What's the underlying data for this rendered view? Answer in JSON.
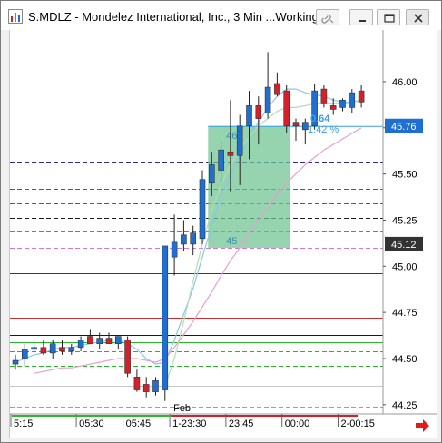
{
  "window": {
    "title": "S.MDLZ - Mondelez International, Inc., 3 Min ...Working...",
    "buttons": [
      "link",
      "minimize",
      "restore",
      "close"
    ]
  },
  "colors": {
    "up": "#1f6fd1",
    "down": "#d32029",
    "target_box": "#6cc38f",
    "measure_text": "#3aa0dd",
    "price_badge_current": "#1f6fd1",
    "price_badge_other": "#333333",
    "scroll_arrow": "#e41a1a"
  },
  "chart_data": {
    "type": "candlestick",
    "ylim": [
      44.2,
      46.28
    ],
    "y_ticks": [
      "46.00",
      "45.75",
      "45.50",
      "45.25",
      "45.00",
      "44.75",
      "44.50",
      "44.25"
    ],
    "y_tick_values": [
      46.0,
      45.75,
      45.5,
      45.25,
      45.0,
      44.75,
      44.5,
      44.25
    ],
    "x_ticks": [
      "5:15",
      "05:30",
      "05:45",
      "1-23:30",
      "23:45",
      "00:00",
      "2-00:15"
    ],
    "x_tick_bar_index": [
      0,
      7,
      12,
      17,
      23,
      29,
      35
    ],
    "day_label": "Feb",
    "day_label_bar_index": 17,
    "candles": [
      {
        "o": 44.47,
        "h": 44.52,
        "l": 44.44,
        "c": 44.49
      },
      {
        "o": 44.5,
        "h": 44.58,
        "l": 44.46,
        "c": 44.55
      },
      {
        "o": 44.55,
        "h": 44.6,
        "l": 44.53,
        "c": 44.56
      },
      {
        "o": 44.56,
        "h": 44.6,
        "l": 44.52,
        "c": 44.53
      },
      {
        "o": 44.53,
        "h": 44.6,
        "l": 44.5,
        "c": 44.58
      },
      {
        "o": 44.56,
        "h": 44.6,
        "l": 44.52,
        "c": 44.54
      },
      {
        "o": 44.54,
        "h": 44.58,
        "l": 44.52,
        "c": 44.56
      },
      {
        "o": 44.56,
        "h": 44.62,
        "l": 44.54,
        "c": 44.6
      },
      {
        "o": 44.62,
        "h": 44.66,
        "l": 44.58,
        "c": 44.58
      },
      {
        "o": 44.58,
        "h": 44.64,
        "l": 44.55,
        "c": 44.61
      },
      {
        "o": 44.61,
        "h": 44.64,
        "l": 44.58,
        "c": 44.58
      },
      {
        "o": 44.58,
        "h": 44.62,
        "l": 44.55,
        "c": 44.62
      },
      {
        "o": 44.6,
        "h": 44.62,
        "l": 44.4,
        "c": 44.42
      },
      {
        "o": 44.4,
        "h": 44.44,
        "l": 44.32,
        "c": 44.33
      },
      {
        "o": 44.36,
        "h": 44.4,
        "l": 44.29,
        "c": 44.32
      },
      {
        "o": 44.32,
        "h": 44.4,
        "l": 44.3,
        "c": 44.38
      },
      {
        "o": 44.33,
        "h": 45.11,
        "l": 44.27,
        "c": 45.11
      },
      {
        "o": 45.05,
        "h": 45.28,
        "l": 44.95,
        "c": 45.13
      },
      {
        "o": 45.12,
        "h": 45.25,
        "l": 45.08,
        "c": 45.17
      },
      {
        "o": 45.12,
        "h": 45.22,
        "l": 45.06,
        "c": 45.18
      },
      {
        "o": 45.15,
        "h": 45.52,
        "l": 45.12,
        "c": 45.47
      },
      {
        "o": 45.45,
        "h": 45.62,
        "l": 45.38,
        "c": 45.55
      },
      {
        "o": 45.52,
        "h": 45.68,
        "l": 45.45,
        "c": 45.63
      },
      {
        "o": 45.62,
        "h": 45.9,
        "l": 45.4,
        "c": 45.6
      },
      {
        "o": 45.6,
        "h": 45.82,
        "l": 45.44,
        "c": 45.76
      },
      {
        "o": 45.76,
        "h": 45.95,
        "l": 45.58,
        "c": 45.87
      },
      {
        "o": 45.87,
        "h": 45.92,
        "l": 45.66,
        "c": 45.8
      },
      {
        "o": 45.83,
        "h": 46.16,
        "l": 45.8,
        "c": 45.97
      },
      {
        "o": 45.99,
        "h": 46.05,
        "l": 45.92,
        "c": 45.93
      },
      {
        "o": 45.95,
        "h": 45.98,
        "l": 45.72,
        "c": 45.76
      },
      {
        "o": 45.78,
        "h": 45.8,
        "l": 45.68,
        "c": 45.76
      },
      {
        "o": 45.74,
        "h": 45.8,
        "l": 45.66,
        "c": 45.78
      },
      {
        "o": 45.76,
        "h": 45.99,
        "l": 45.74,
        "c": 45.95
      },
      {
        "o": 45.96,
        "h": 45.98,
        "l": 45.86,
        "c": 45.88
      },
      {
        "o": 45.87,
        "h": 45.91,
        "l": 45.82,
        "c": 45.85
      },
      {
        "o": 45.86,
        "h": 45.91,
        "l": 45.84,
        "c": 45.9
      },
      {
        "o": 45.86,
        "h": 45.96,
        "l": 45.83,
        "c": 45.94
      },
      {
        "o": 45.95,
        "h": 45.98,
        "l": 45.86,
        "c": 45.89
      }
    ],
    "horizontal_levels": [
      {
        "y": 45.56,
        "color": "#2b2ba8",
        "dash": true
      },
      {
        "y": 45.42,
        "color": "#8a3a8a",
        "dash": true
      },
      {
        "y": 45.34,
        "color": "#c03030",
        "dash": true
      },
      {
        "y": 45.26,
        "color": "#1a1a1a",
        "dash": true
      },
      {
        "y": 45.19,
        "color": "#29b429",
        "dash": true
      },
      {
        "y": 45.1,
        "color": "#d27ad2",
        "dash": true
      },
      {
        "y": 44.96,
        "color": "#2b2bb8",
        "dash": false
      },
      {
        "y": 44.82,
        "color": "#8a3a8a",
        "dash": false
      },
      {
        "y": 44.72,
        "color": "#c03030",
        "dash": false
      },
      {
        "y": 44.63,
        "color": "#1a1a1a",
        "dash": false
      },
      {
        "y": 44.59,
        "color": "#29b429",
        "dash": false
      },
      {
        "y": 44.54,
        "color": "#29b429",
        "dash": true
      },
      {
        "y": 44.5,
        "color": "#29b429",
        "dash": false
      },
      {
        "y": 44.46,
        "color": "#29b429",
        "dash": true
      },
      {
        "y": 44.35,
        "color": "#c8c8c8",
        "dash": false
      },
      {
        "y": 44.24,
        "color": "#d27ad2",
        "dash": true
      }
    ],
    "moving_averages": [
      {
        "name": "",
        "color": "#8cc4ec",
        "values": [
          44.48,
          44.5,
          44.52,
          44.53,
          44.55,
          44.56,
          44.56,
          44.57,
          44.58,
          44.59,
          44.6,
          44.6,
          44.58,
          44.55,
          44.5,
          44.47,
          44.48,
          44.6,
          44.74,
          44.88,
          45.05,
          45.22,
          45.38,
          45.5,
          45.6,
          45.7,
          45.78,
          45.86,
          45.92,
          45.96,
          45.96,
          45.94,
          45.93,
          45.92,
          45.9,
          45.89,
          45.89,
          45.9
        ]
      },
      {
        "name": "",
        "color": "#b4dcb4",
        "values": [
          null,
          null,
          null,
          null,
          null,
          null,
          null,
          null,
          null,
          null,
          null,
          null,
          null,
          null,
          null,
          null,
          44.35,
          44.5,
          44.7,
          44.92,
          45.12,
          45.3,
          45.44,
          45.55,
          45.63,
          45.7,
          45.76,
          45.8,
          45.84,
          45.86,
          45.86,
          45.87,
          45.88,
          45.88,
          45.88,
          45.88,
          45.88,
          45.89
        ]
      },
      {
        "name": "",
        "color": "#e6a0d2",
        "values": [
          null,
          null,
          44.42,
          44.43,
          44.44,
          44.45,
          44.45,
          44.46,
          44.47,
          44.48,
          44.49,
          44.5,
          44.5,
          44.5,
          44.49,
          44.48,
          44.5,
          44.56,
          44.63,
          44.7,
          44.78,
          44.86,
          44.95,
          45.03,
          45.1,
          45.18,
          45.25,
          45.32,
          45.39,
          45.45,
          45.5,
          45.55,
          45.59,
          45.63,
          45.66,
          45.69,
          45.72,
          45.75
        ]
      }
    ],
    "measure_box": {
      "x_start_bar": 21,
      "x_end_bar": 29,
      "y_top": 45.76,
      "y_bottom": 45.1,
      "top_label": "46",
      "bottom_label": "45"
    },
    "measure_text": {
      "change": "0.64",
      "percent": "1.42 %"
    },
    "price_badges": [
      {
        "label": "45.76",
        "y": 45.76,
        "kind": "current"
      },
      {
        "label": "45.12",
        "y": 45.12,
        "kind": "other"
      }
    ],
    "timeline_bar": {
      "segments": [
        {
          "from_bar": 0,
          "to_bar": 17,
          "color": "#2db82d"
        },
        {
          "from_bar": 17,
          "to_bar": 37,
          "color": "#d32029"
        }
      ]
    }
  }
}
